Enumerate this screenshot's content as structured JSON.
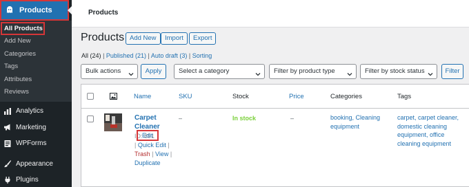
{
  "sidebar": {
    "top_item": {
      "label": "Products",
      "icon": "woocommerce-icon"
    },
    "submenu": [
      {
        "label": "All Products",
        "current": true
      },
      {
        "label": "Add New"
      },
      {
        "label": "Categories"
      },
      {
        "label": "Tags"
      },
      {
        "label": "Attributes"
      },
      {
        "label": "Reviews"
      }
    ],
    "menu": [
      {
        "label": "Analytics",
        "icon": "bar-chart-icon"
      },
      {
        "label": "Marketing",
        "icon": "megaphone-icon"
      },
      {
        "label": "WPForms",
        "icon": "form-icon"
      },
      {
        "label": "Appearance",
        "icon": "paintbrush-icon"
      },
      {
        "label": "Plugins",
        "icon": "plug-icon"
      }
    ]
  },
  "topbar": {
    "title": "Products"
  },
  "page": {
    "heading": "Products",
    "buttons": {
      "add_new": "Add New",
      "import": "Import",
      "export": "Export"
    }
  },
  "views": {
    "all": "All",
    "all_count": "(24)",
    "published": "Published",
    "published_count": "(21)",
    "auto_draft": "Auto draft",
    "auto_draft_count": "(3)",
    "sorting": "Sorting",
    "separator": "|"
  },
  "filters": {
    "bulk_actions": "Bulk actions",
    "apply": "Apply",
    "category": "Select a category",
    "product_type": "Filter by product type",
    "stock_status": "Filter by stock status",
    "filter": "Filter"
  },
  "table": {
    "columns": {
      "name": "Name",
      "sku": "SKU",
      "stock": "Stock",
      "price": "Price",
      "categories": "Categories",
      "tags": "Tags"
    },
    "row": {
      "name": "Carpet Cleaner",
      "id": "ID: 891",
      "sep": "|",
      "edit": "Edit",
      "quick_edit": "Quick Edit",
      "trash": "Trash",
      "view": "View",
      "duplicate": "Duplicate",
      "sku": "–",
      "stock": "In stock",
      "price": "–",
      "categories": "booking, Cleaning equipment",
      "tags": "carpet, carpet cleaner, domestic cleaning equipment, office cleaning equipment"
    }
  },
  "colors": {
    "sidebar": "#1d2327",
    "accent": "#2271b1",
    "highlight": "#d63638",
    "in_stock": "#7ad03a"
  }
}
